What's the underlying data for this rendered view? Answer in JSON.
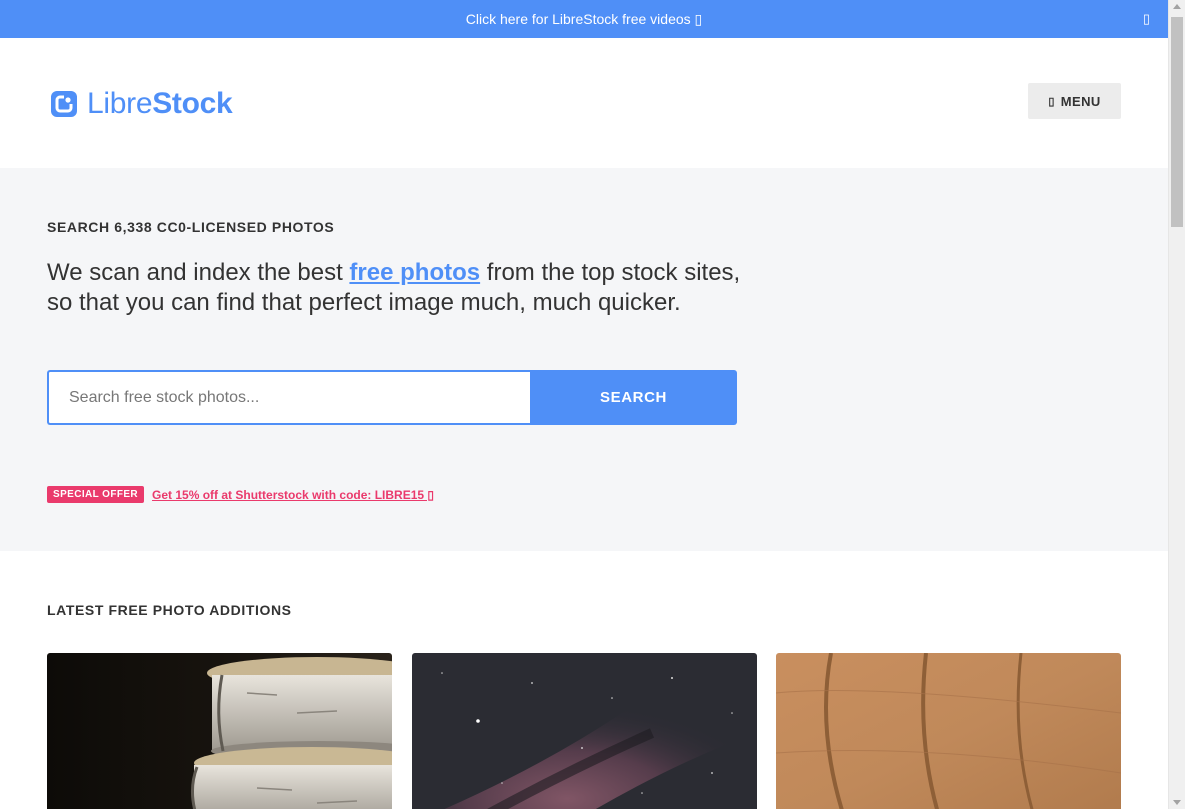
{
  "banner": {
    "text": "Click here for LibreStock free videos ▯",
    "close_icon": "close-icon",
    "close_glyph": "▯"
  },
  "header": {
    "logo": {
      "light": "Libre",
      "bold": "Stock",
      "icon": "librestock-logo-icon"
    },
    "menu": {
      "label": "MENU",
      "icon": "menu-icon",
      "icon_glyph": "▯"
    }
  },
  "hero": {
    "eyebrow": "SEARCH 6,338 CC0-LICENSED PHOTOS",
    "tagline_before": "We scan and index the best ",
    "tagline_link": "free photos",
    "tagline_after": " from the top stock sites, so that you can find that perfect image much, much quicker.",
    "search": {
      "placeholder": "Search free stock photos...",
      "value": "",
      "button": "SEARCH"
    },
    "offer": {
      "badge": "SPECIAL OFFER",
      "link": "Get 15% off at Shutterstock with code: LIBRE15 ▯"
    }
  },
  "latest": {
    "title": "LATEST FREE PHOTO ADDITIONS",
    "photos": [
      {
        "subject": "stacked wood slices"
      },
      {
        "subject": "milky way night sky"
      },
      {
        "subject": "dry brown leaf texture"
      }
    ]
  },
  "colors": {
    "accent": "#4f8ff7",
    "offer": "#ea3a6c",
    "hero_bg": "#f5f6f8"
  }
}
